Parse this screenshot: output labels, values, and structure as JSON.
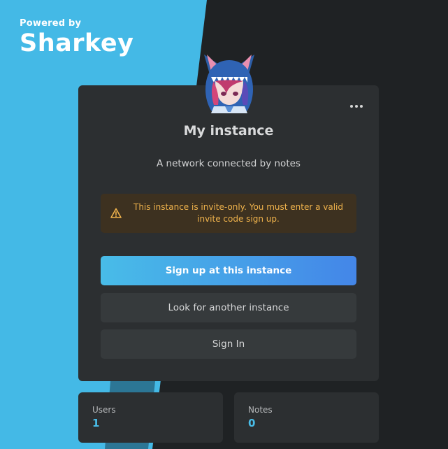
{
  "branding": {
    "powered_by": "Powered by",
    "brand_name": "Sharkey"
  },
  "instance": {
    "name": "My instance",
    "description": "A network connected by notes",
    "avatar_icon": "shark-hood-avatar",
    "more_icon": "more-dots-icon"
  },
  "notice": {
    "icon": "warning-icon",
    "text": "This instance is invite-only. You must enter a valid invite code sign up.",
    "color": "#f0b34c"
  },
  "actions": {
    "signup_label": "Sign up at this instance",
    "look_label": "Look for another instance",
    "signin_label": "Sign In"
  },
  "stats": {
    "users_label": "Users",
    "users_value": "1",
    "notes_label": "Notes",
    "notes_value": "0"
  },
  "colors": {
    "accent": "#44b9e6",
    "primary_gradient_start": "#48bce8",
    "primary_gradient_end": "#4486e8",
    "card_bg": "#2c2f31"
  }
}
